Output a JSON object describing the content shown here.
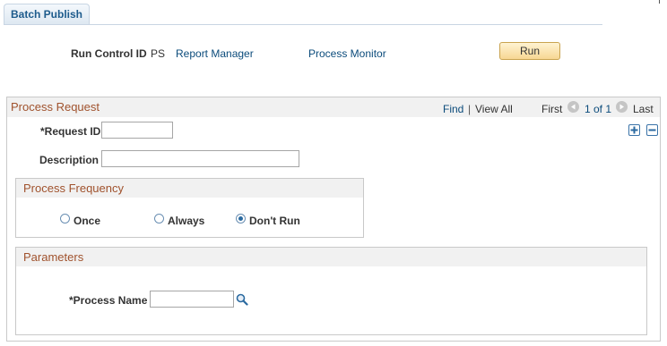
{
  "tab": {
    "label": "Batch Publish"
  },
  "header": {
    "run_control_label": "Run Control ID",
    "run_control_value": "PS",
    "report_manager": "Report Manager",
    "process_monitor": "Process Monitor",
    "run_button": "Run"
  },
  "process_request": {
    "title": "Process Request",
    "find": "Find",
    "separator": "|",
    "view_all": "View All",
    "first": "First",
    "pager": "1 of 1",
    "last": "Last",
    "request_id_label": "*Request ID",
    "request_id_value": "",
    "description_label": "Description",
    "description_value": "",
    "frequency": {
      "title": "Process Frequency",
      "options": [
        "Once",
        "Always",
        "Don't Run"
      ],
      "selected": "Don't Run"
    },
    "parameters": {
      "title": "Parameters",
      "process_name_label": "*Process Name",
      "process_name_value": ""
    }
  }
}
